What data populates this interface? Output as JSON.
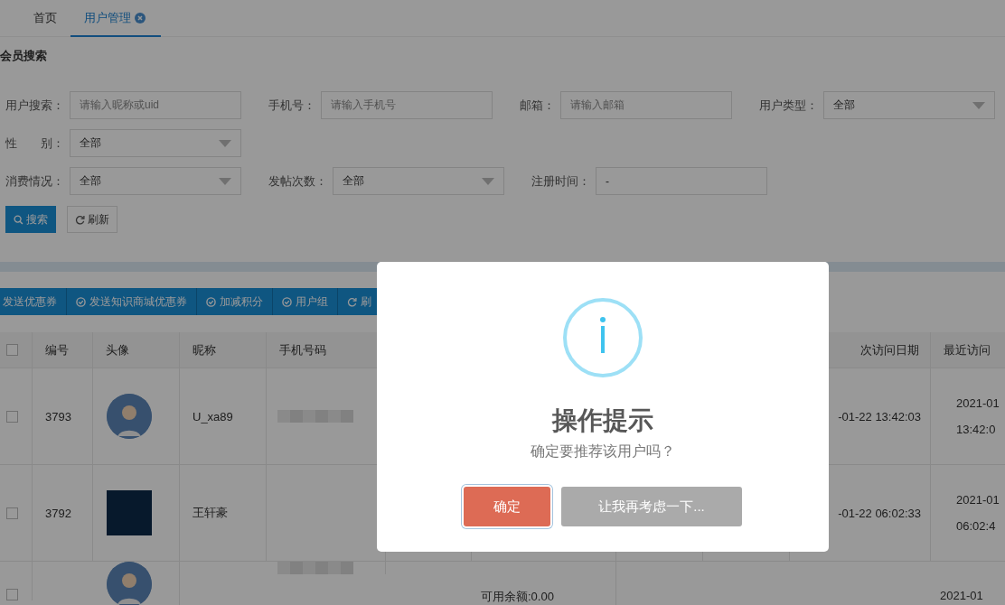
{
  "tabs": [
    {
      "label": "首页",
      "selected": false,
      "closable": false
    },
    {
      "label": "用户管理",
      "selected": true,
      "closable": true
    }
  ],
  "search_panel": {
    "title": "会员搜索",
    "rows": [
      [
        {
          "label": "用户搜索：",
          "kind": "input",
          "placeholder": "请输入昵称或uid"
        },
        {
          "label": "手机号：",
          "kind": "input",
          "placeholder": "请输入手机号"
        },
        {
          "label": "邮箱：",
          "kind": "input",
          "placeholder": "请输入邮箱"
        },
        {
          "label": "用户类型：",
          "kind": "select",
          "value": "全部"
        }
      ],
      [
        {
          "label": "性　　别：",
          "kind": "select",
          "value": "全部"
        }
      ],
      [
        {
          "label": "消费情况：",
          "kind": "select",
          "value": "全部"
        },
        {
          "label": "发帖次数：",
          "kind": "select",
          "value": "全部"
        },
        {
          "label": "注册时间：",
          "kind": "input",
          "value": "-"
        }
      ]
    ],
    "buttons": [
      {
        "label": "搜索",
        "kind": "primary"
      },
      {
        "label": "刷新",
        "kind": "default"
      }
    ]
  },
  "toolbar": [
    {
      "label": "发送优惠券",
      "kind": "plain"
    },
    {
      "label": "发送知识商城优惠券",
      "kind": "check"
    },
    {
      "label": "加减积分",
      "kind": "check"
    },
    {
      "label": "用户组",
      "kind": "check"
    },
    {
      "label": "刷",
      "kind": "refresh"
    }
  ],
  "table": {
    "columns": [
      {
        "kind": "checkbox",
        "checked": false
      },
      {
        "label": "编号"
      },
      {
        "label": "头像"
      },
      {
        "label": "昵称"
      },
      {
        "label": "手机号码"
      },
      {},
      {},
      {},
      {},
      {
        "label": "次访问日期",
        "kind": "right"
      },
      {
        "label": "最近访问"
      }
    ],
    "rows": [
      {
        "cells": [
          {
            "kind": "checkbox",
            "checked": false
          },
          {
            "text": "3793"
          },
          {
            "kind": "avatar"
          },
          {
            "text": "U_xa89"
          },
          {
            "kind": "redacted"
          },
          {},
          {},
          {},
          {},
          {
            "text": "-01-22 13:42:03",
            "kind": "date"
          },
          {
            "kind": "lines",
            "lines": [
              "2021-01",
              "13:42:0"
            ]
          }
        ]
      },
      {
        "cells": [
          {
            "kind": "checkbox",
            "checked": false
          },
          {
            "text": "3792"
          },
          {
            "kind": "photo"
          },
          {
            "text": "王轩豪"
          },
          {},
          {},
          {},
          {},
          {},
          {
            "text": "-01-22 06:02:33",
            "kind": "date"
          },
          {
            "kind": "lines",
            "lines": [
              "2021-01",
              "06:02:4"
            ]
          }
        ]
      },
      {
        "cells": [
          {
            "kind": "checkbox",
            "checked": false
          },
          {},
          {
            "kind": "avatar"
          },
          {},
          {
            "kind": "redacted"
          },
          {},
          {
            "text": "可用余额:0.00",
            "kind": "top"
          },
          {},
          {},
          {},
          {
            "kind": "top",
            "text": "2021-01"
          }
        ]
      }
    ]
  },
  "dialog": {
    "title": "操作提示",
    "message": "确定要推荐该用户吗？",
    "confirm": "确定",
    "cancel": "让我再考虑一下..."
  }
}
